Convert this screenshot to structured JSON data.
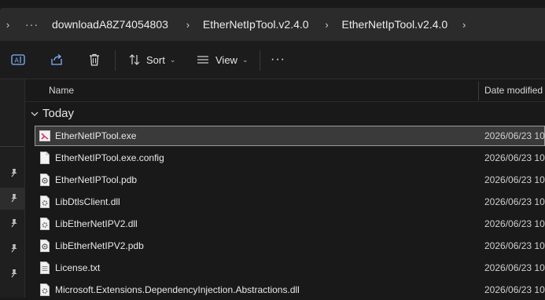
{
  "breadcrumb": {
    "overflow": "···",
    "items": [
      "downloadA8Z74054803",
      "EtherNetIpTool.v2.4.0",
      "EtherNetIpTool.v2.4.0"
    ]
  },
  "toolbar": {
    "sort_label": "Sort",
    "view_label": "View",
    "more_label": "···"
  },
  "columns": {
    "name": "Name",
    "date": "Date modified"
  },
  "group": {
    "label": "Today"
  },
  "files": [
    {
      "name": "EtherNetIPTool.exe",
      "date": "2026/06/23 10:",
      "icon": "exe-icon",
      "selected": true
    },
    {
      "name": "EtherNetIPTool.exe.config",
      "date": "2026/06/23 10:",
      "icon": "file-icon"
    },
    {
      "name": "EtherNetIPTool.pdb",
      "date": "2026/06/23 10:",
      "icon": "pdb-icon"
    },
    {
      "name": "LibDtlsClient.dll",
      "date": "2026/06/23 10:",
      "icon": "dll-icon"
    },
    {
      "name": "LibEtherNetIPV2.dll",
      "date": "2026/06/23 10:",
      "icon": "dll-icon"
    },
    {
      "name": "LibEtherNetIPV2.pdb",
      "date": "2026/06/23 10:",
      "icon": "pdb-icon"
    },
    {
      "name": "License.txt",
      "date": "2026/06/23 10:",
      "icon": "text-file-icon"
    },
    {
      "name": "Microsoft.Extensions.DependencyInjection.Abstractions.dll",
      "date": "2026/06/23 10:",
      "icon": "dll-icon"
    }
  ],
  "colors": {
    "background": "#191919",
    "address_bar": "#2b2b2b",
    "selection": "#3a3a3a",
    "exe_accent": "#d9326e"
  }
}
